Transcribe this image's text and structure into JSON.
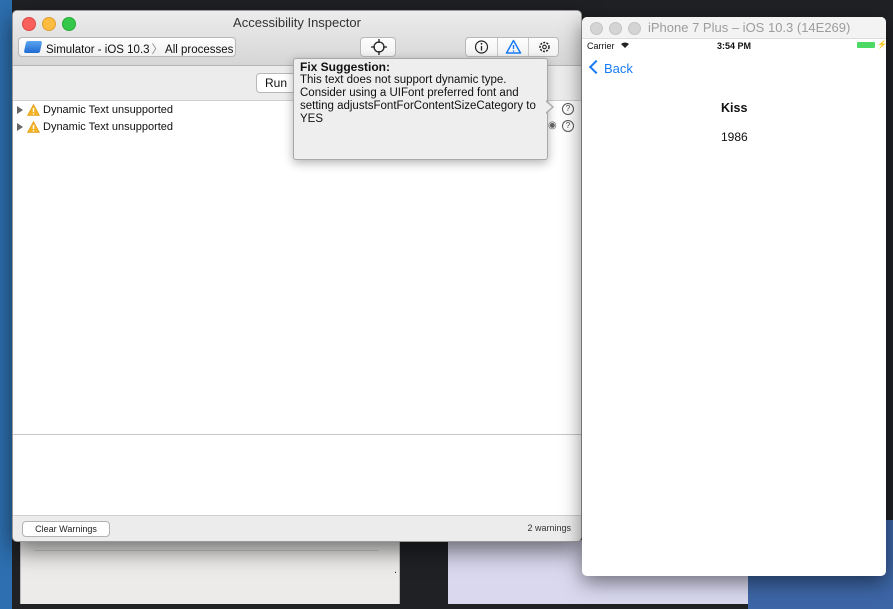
{
  "inspector": {
    "title": "Accessibility Inspector",
    "target_device": "Simulator - iOS 10.3",
    "target_scope": "All processes",
    "run_label": "Run",
    "warnings": [
      {
        "label": "Dynamic Text unsupported"
      },
      {
        "label": "Dynamic Text unsupported"
      }
    ],
    "clear_label": "Clear Warnings",
    "warnings_count": "2 warnings",
    "popover": {
      "title": "Fix Suggestion:",
      "body": "This text does not support dynamic type. Consider using a UIFont preferred font and setting adjustsFontForContentSizeCategory to YES"
    },
    "icons": {
      "target": "simulator-icon",
      "crosshair": "crosshair-icon",
      "info": "info-icon",
      "audit": "warning-icon",
      "settings": "gear-icon",
      "warning_row": "warning-icon",
      "help": "question-icon",
      "eye": "eye-icon"
    },
    "accent": "#1a7cf5"
  },
  "simulator": {
    "title": "iPhone 7 Plus – iOS 10.3 (14E269)",
    "carrier": "Carrier",
    "time": "3:54 PM",
    "back_label": "Back",
    "song_title": "Kiss",
    "song_year": "1986",
    "battery_color": "#4cd964"
  },
  "background": {
    "partial_text": "."
  }
}
